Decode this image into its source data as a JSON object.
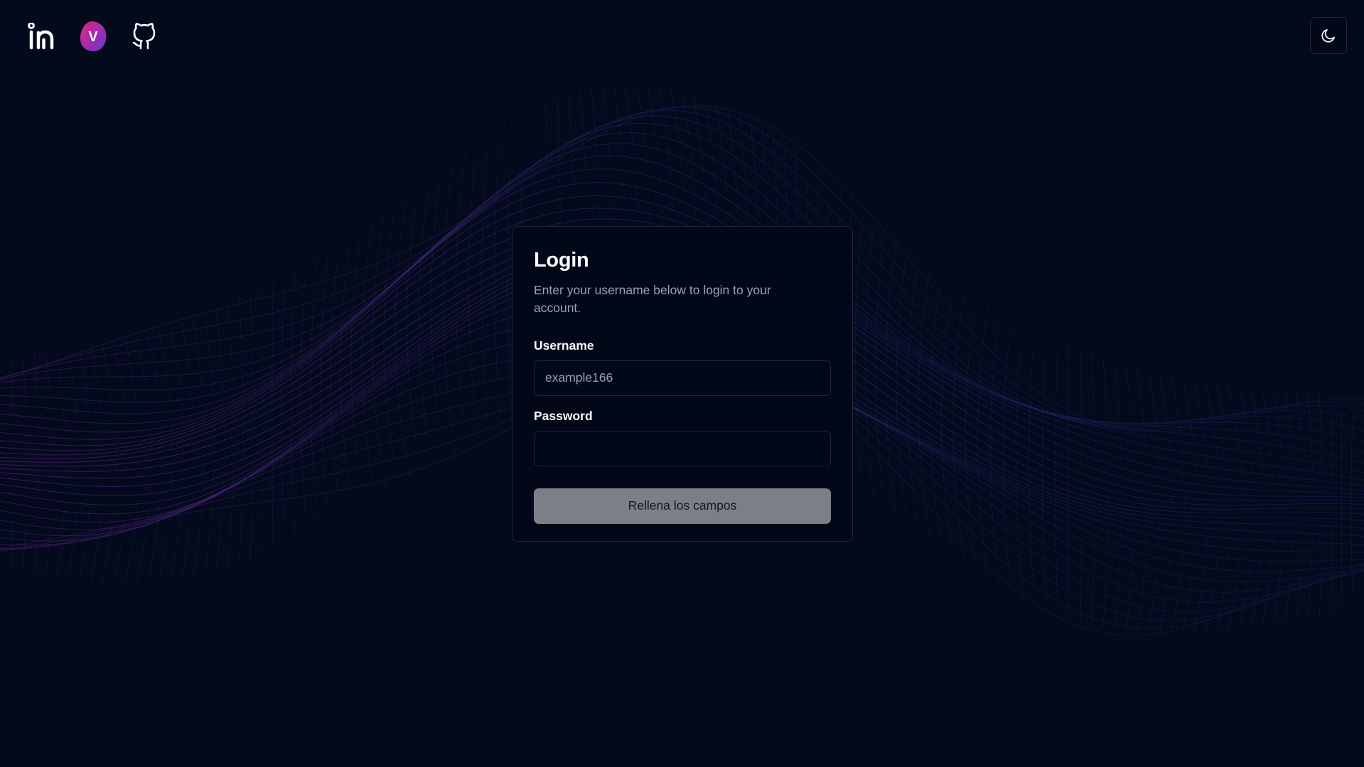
{
  "header": {
    "links": [
      {
        "name": "linkedin",
        "icon": "linkedin-icon"
      },
      {
        "name": "portfolio",
        "icon": "v-logo-icon",
        "logo_letter": "V"
      },
      {
        "name": "github",
        "icon": "github-icon"
      }
    ],
    "theme_toggle": {
      "icon": "moon-icon"
    }
  },
  "login": {
    "title": "Login",
    "description": "Enter your username below to login to your account.",
    "username_label": "Username",
    "username_placeholder": "example166",
    "username_value": "",
    "password_label": "Password",
    "password_value": "",
    "submit_label": "Rellena los campos"
  },
  "colors": {
    "background": "#030a1c",
    "card_border": "#1e293b",
    "muted_text": "#94a3b8",
    "button_disabled": "#7c7f88",
    "wave_purple": "#9b2bbd",
    "wave_blue": "#3b3fa8"
  }
}
